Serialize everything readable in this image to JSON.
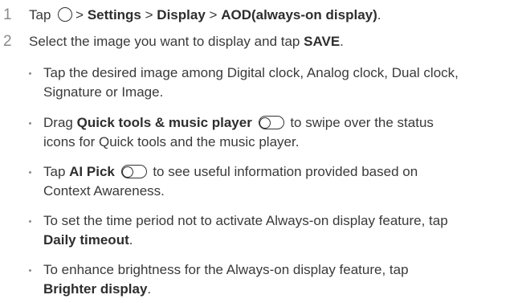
{
  "steps": [
    {
      "number": "1",
      "text": {
        "pre": "Tap",
        "sep1": ">",
        "settings": "Settings",
        "sep2": ">",
        "display": "Display",
        "sep3": ">",
        "aod": "AOD(always-on display)",
        "end": "."
      }
    },
    {
      "number": "2",
      "text": {
        "pre": "Select the image you want to display and tap",
        "save": "SAVE",
        "end": "."
      }
    }
  ],
  "bullets": [
    {
      "line1": "Tap the desired image among Digital clock, Analog clock, Dual clock,",
      "line2": "Signature or Image."
    },
    {
      "pre": "Drag",
      "bold": "Quick tools & music player",
      "post": "to swipe over the status",
      "line2": "icons for Quick tools and the music player."
    },
    {
      "pre": "Tap",
      "bold": "AI Pick",
      "post": "to see useful information provided based on",
      "line2": "Context Awareness."
    },
    {
      "line1": "To set the time period not to activate Always-on display feature, tap",
      "bold": "Daily timeout",
      "end": "."
    },
    {
      "line1": "To enhance brightness for the Always-on display feature, tap",
      "bold": "Brighter display",
      "end": "."
    }
  ],
  "icons": {
    "home": "home-button-icon",
    "toggle": "toggle-switch-icon"
  }
}
